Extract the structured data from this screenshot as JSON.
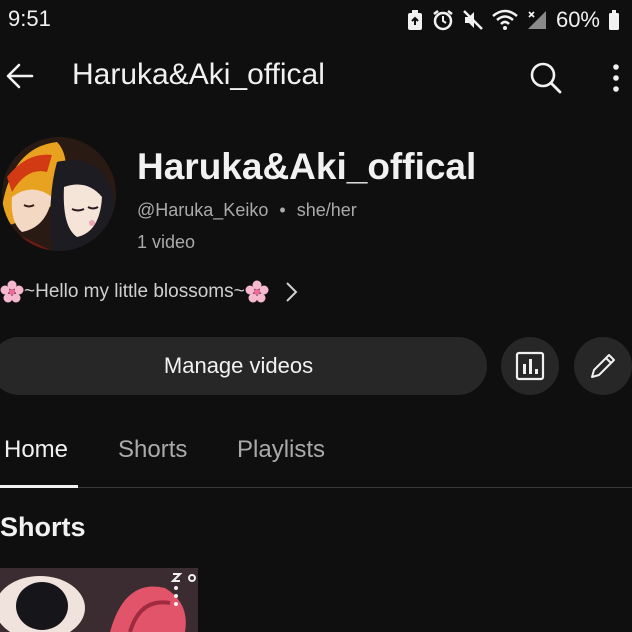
{
  "status_bar": {
    "time": "9:51",
    "battery": "60%",
    "icons": [
      "recycle-icon",
      "alarm-icon",
      "mute-icon",
      "wifi-icon",
      "signal-icon",
      "battery-icon"
    ]
  },
  "app_bar": {
    "title": "Haruka&Aki_offical",
    "back_icon": "arrow-left-icon",
    "search_icon": "search-icon",
    "more_icon": "more-vertical-icon"
  },
  "channel": {
    "name": "Haruka&Aki_offical",
    "handle": "@Haruka_Keiko",
    "separator": "•",
    "pronouns": "she/her",
    "video_count": "1 video",
    "description": "~Hello my little blossoms~"
  },
  "actions": {
    "manage_label": "Manage videos",
    "stats_icon": "analytics-icon",
    "edit_icon": "pencil-icon"
  },
  "tabs": [
    {
      "label": "Home",
      "active": true
    },
    {
      "label": "Shorts",
      "active": false
    },
    {
      "label": "Playlists",
      "active": false
    }
  ],
  "section": {
    "title": "Shorts"
  },
  "colors": {
    "background": "#0f0f0f",
    "surface": "#272727",
    "text": "#f1f1f1",
    "secondary_text": "#aaaaaa"
  }
}
